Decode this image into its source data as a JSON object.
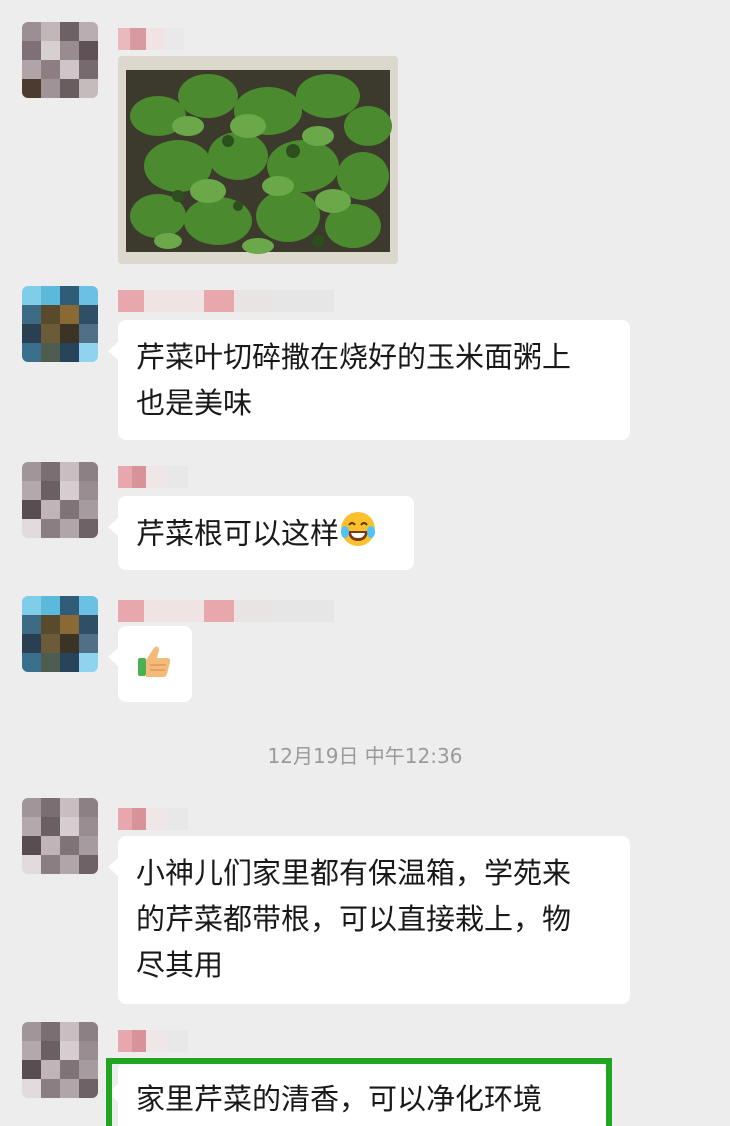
{
  "messages": [
    {
      "text": ""
    },
    {
      "text_line1": "芹菜叶切碎撒在烧好的玉米面粥上",
      "text_line2": "也是美味"
    },
    {
      "text": "芹菜根可以这样"
    },
    {
      "emoji": "thumbs-up"
    },
    {
      "text_line1": "小神儿们家里都有保温箱，学苑来",
      "text_line2": "的芹菜都带根，可以直接栽上，物",
      "text_line3": "尽其用"
    },
    {
      "text": "家里芹菜的清香，可以净化环境"
    }
  ],
  "timestamp": "12月19日 中午12:36",
  "icons": [
    "laughing-tears-emoji",
    "thumbs-up-emoji"
  ],
  "colors": {
    "background": "#ededed",
    "bubble": "#ffffff",
    "highlight_border": "#1fa51f",
    "timestamp": "#9a9a9a"
  }
}
